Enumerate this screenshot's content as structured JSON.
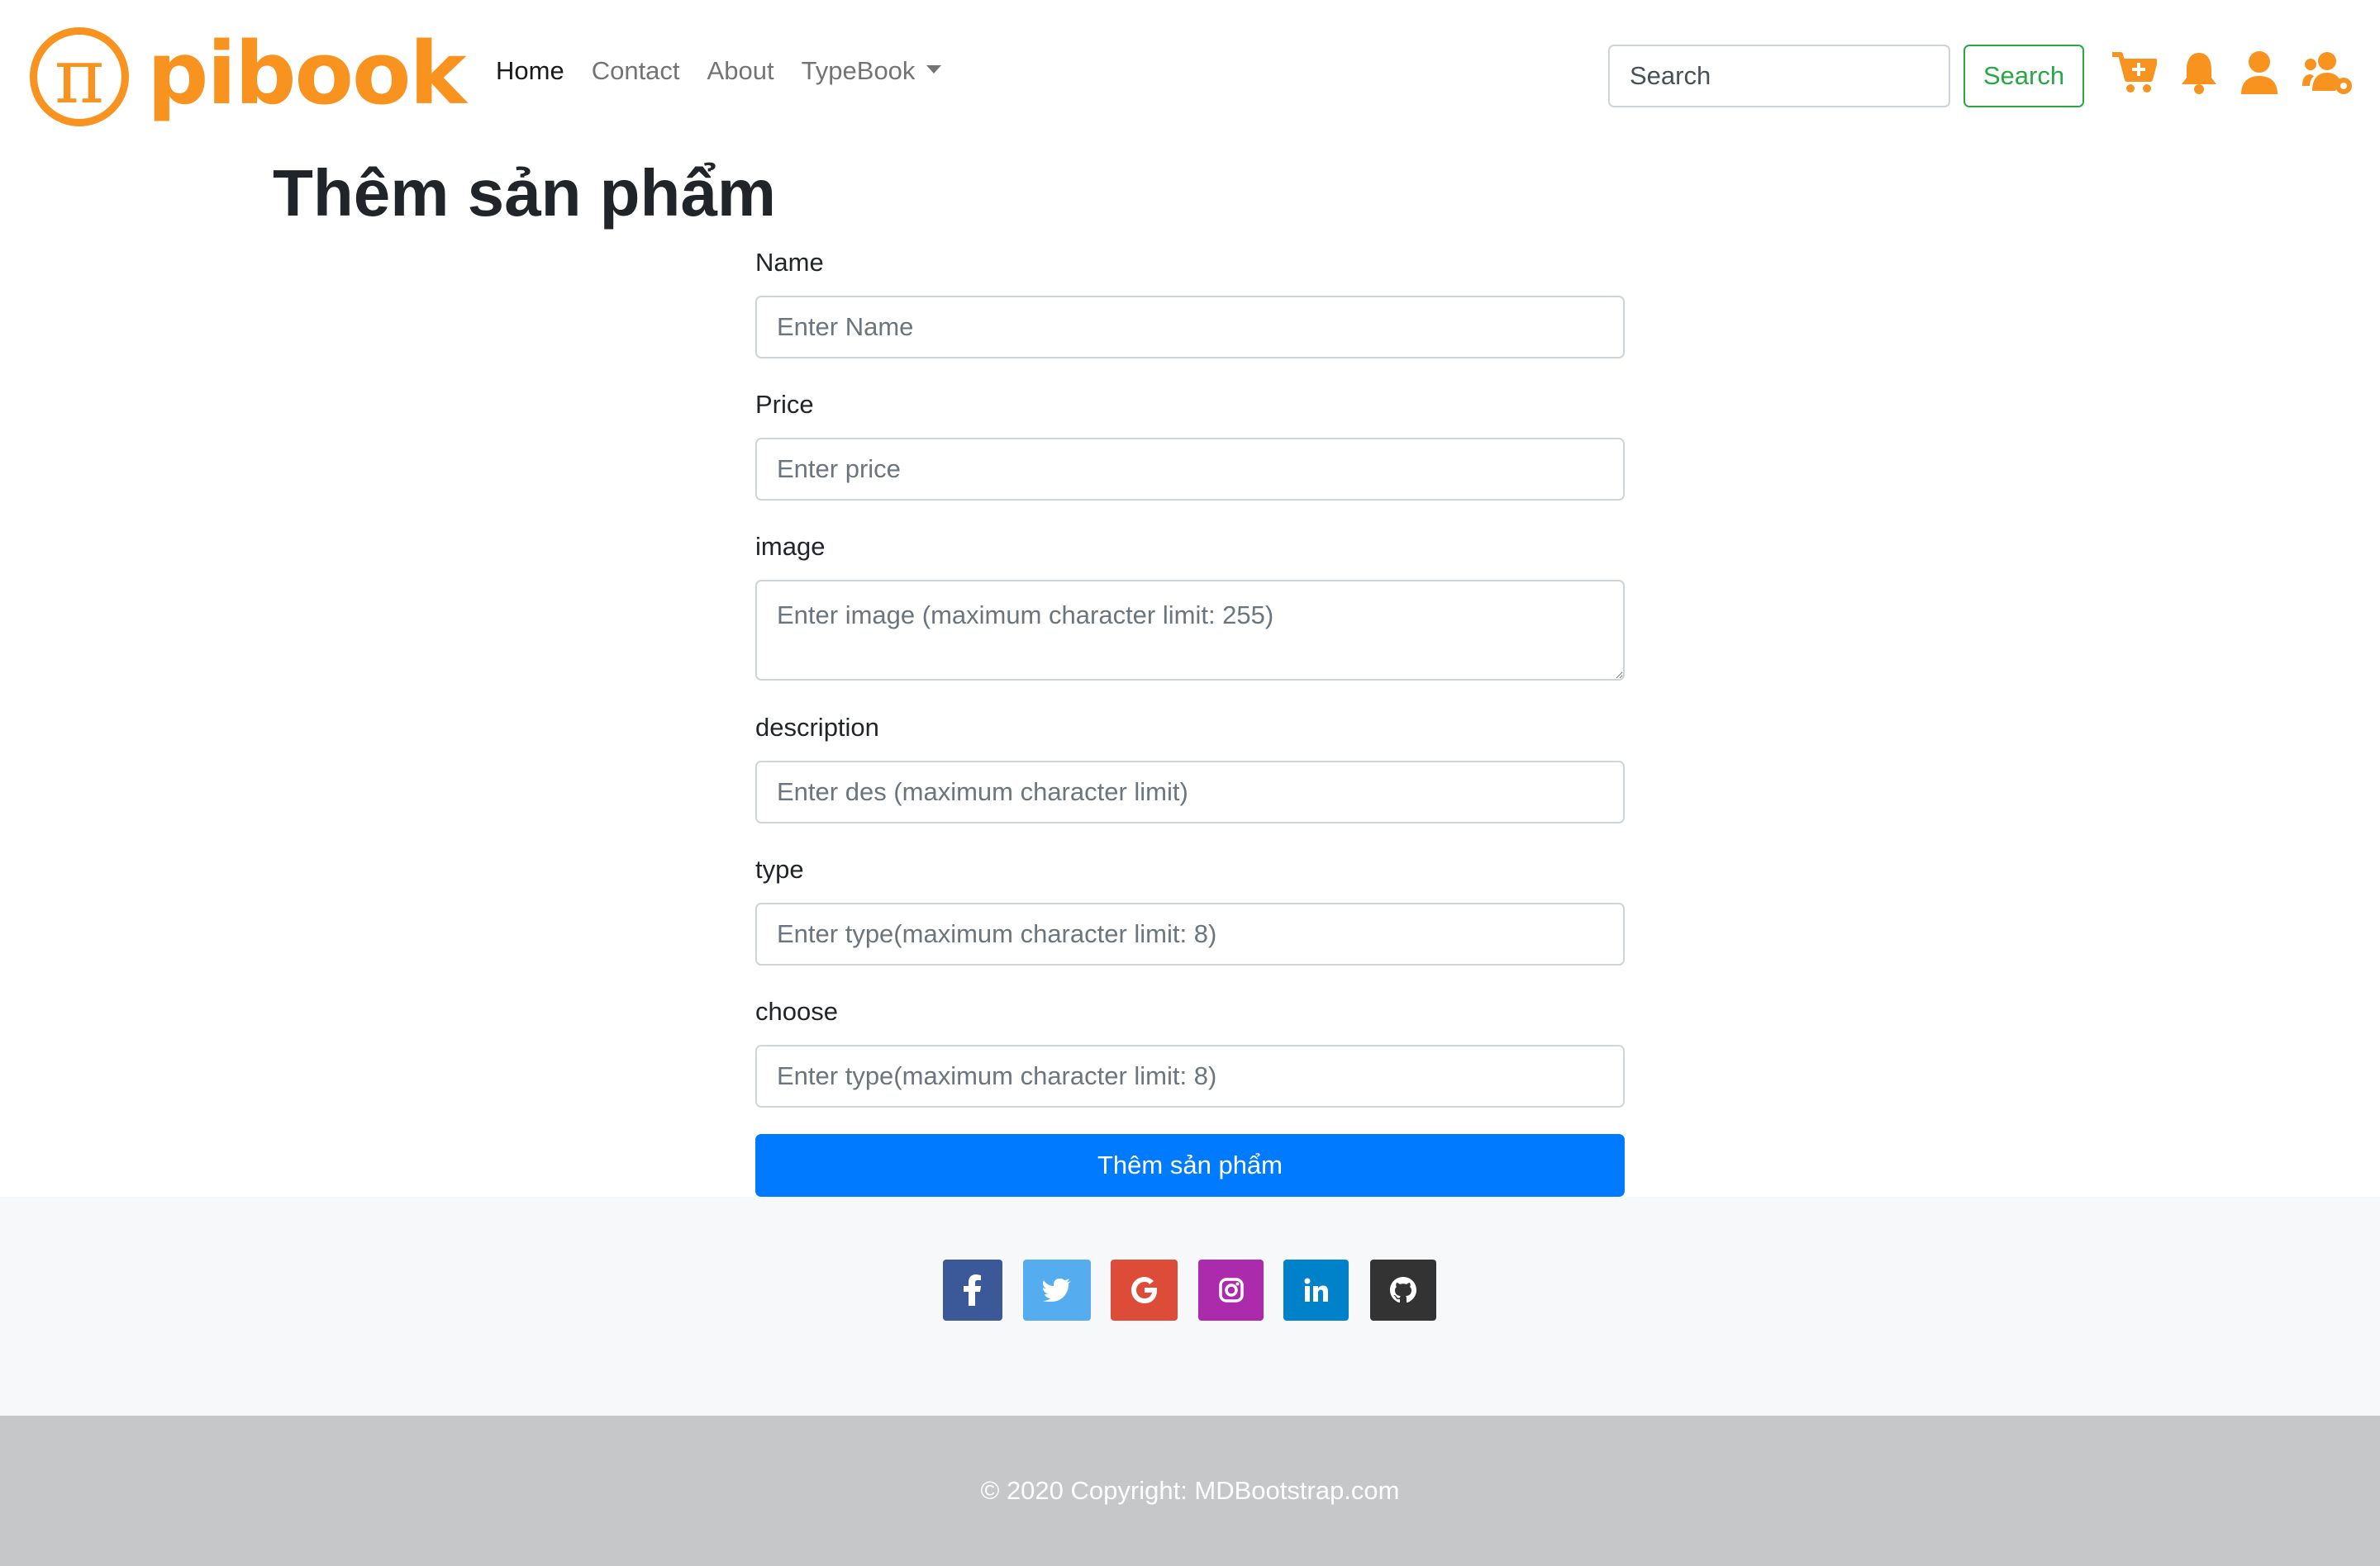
{
  "brand": {
    "logo_symbol": "π",
    "logo_text": "pibook",
    "color": "#f7931e"
  },
  "nav": {
    "links": [
      "Home",
      "Contact",
      "About",
      "TypeBook"
    ],
    "active": "Home"
  },
  "search": {
    "placeholder": "Search",
    "button_label": "Search"
  },
  "header_icons": [
    "cart-plus-icon",
    "bell-icon",
    "user-icon",
    "users-cog-icon"
  ],
  "page": {
    "title": "Thêm sản phẩm"
  },
  "form": {
    "fields": [
      {
        "label": "Name",
        "placeholder": "Enter Name"
      },
      {
        "label": "Price",
        "placeholder": "Enter price"
      },
      {
        "label": "image",
        "placeholder": "Enter image (maximum character limit: 255)"
      },
      {
        "label": "description",
        "placeholder": "Enter des (maximum character limit)"
      },
      {
        "label": "type",
        "placeholder": "Enter type(maximum character limit: 8)"
      },
      {
        "label": "choose",
        "placeholder": "Enter type(maximum character limit: 8)"
      }
    ],
    "submit_label": "Thêm sản phẩm",
    "submit_color": "#007bff"
  },
  "footer": {
    "social": [
      {
        "name": "facebook",
        "glyph": "f",
        "color": "#3b5998"
      },
      {
        "name": "twitter",
        "glyph": "t",
        "color": "#55acee"
      },
      {
        "name": "google",
        "glyph": "G",
        "color": "#dd4b39"
      },
      {
        "name": "instagram",
        "glyph": "ig",
        "color": "#ac2bac"
      },
      {
        "name": "linkedin",
        "glyph": "in",
        "color": "#0082ca"
      },
      {
        "name": "github",
        "glyph": "gh",
        "color": "#333333"
      }
    ],
    "copyright": "© 2020 Copyright: MDBootstrap.com"
  }
}
